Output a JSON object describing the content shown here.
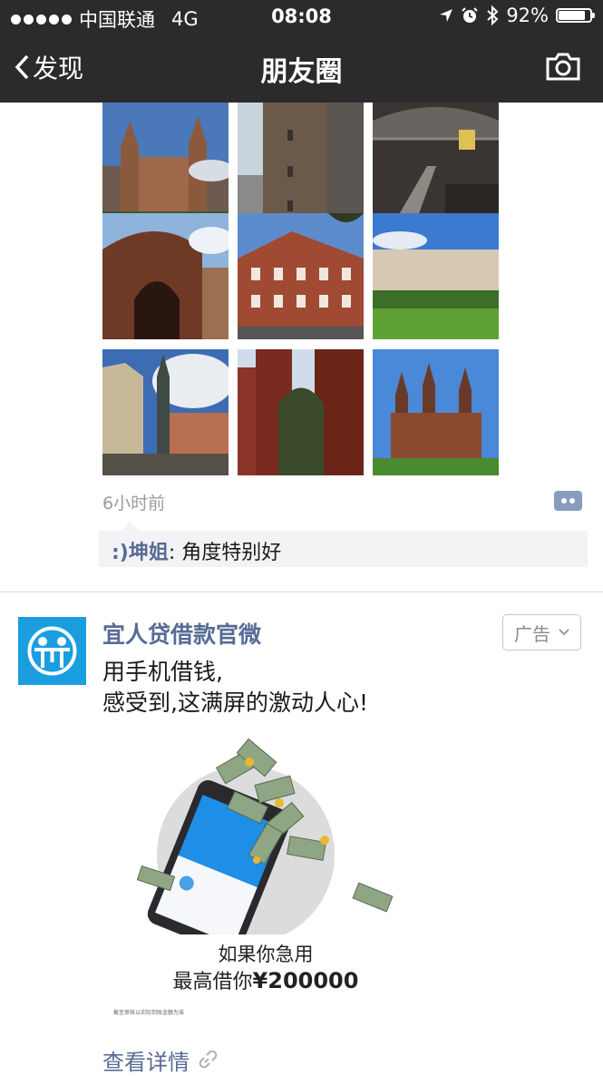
{
  "status_bar": {
    "carrier": "中国联通",
    "network": "4G",
    "time": "08:08",
    "battery": "92%",
    "battery_level": 0.92,
    "icons": [
      "location-arrow-icon",
      "alarm-icon",
      "bluetooth-icon",
      "battery-icon"
    ]
  },
  "nav": {
    "back_label": "发现",
    "title": "朋友圈",
    "camera_icon": "camera-icon"
  },
  "post": {
    "photos": [
      "castle-photo",
      "tower-photo",
      "train-station-photo",
      "arch-photo",
      "brick-building-photo",
      "park-houses-photo",
      "square-photo",
      "red-tower-photo",
      "palace-photo"
    ],
    "timestamp": "6小时前",
    "comment": {
      "author": ":)坤姐",
      "separator": ":",
      "text": " 角度特别好"
    }
  },
  "ad": {
    "name": "宜人贷借款官微",
    "tag": "广告",
    "text_line1": "用手机借钱,",
    "text_line2": "感受到,这满屏的激动人心!",
    "promo_line1": "如果你急用",
    "promo_line2_prefix": "最高借你",
    "promo_amount": "¥200000",
    "fine_print": "截至审核以实际到账金额为准",
    "view_details": "查看详情"
  },
  "colors": {
    "nav_bg": "#2b2b2d",
    "link_blue": "#576b95",
    "ad_blue": "#1a9ee0"
  }
}
